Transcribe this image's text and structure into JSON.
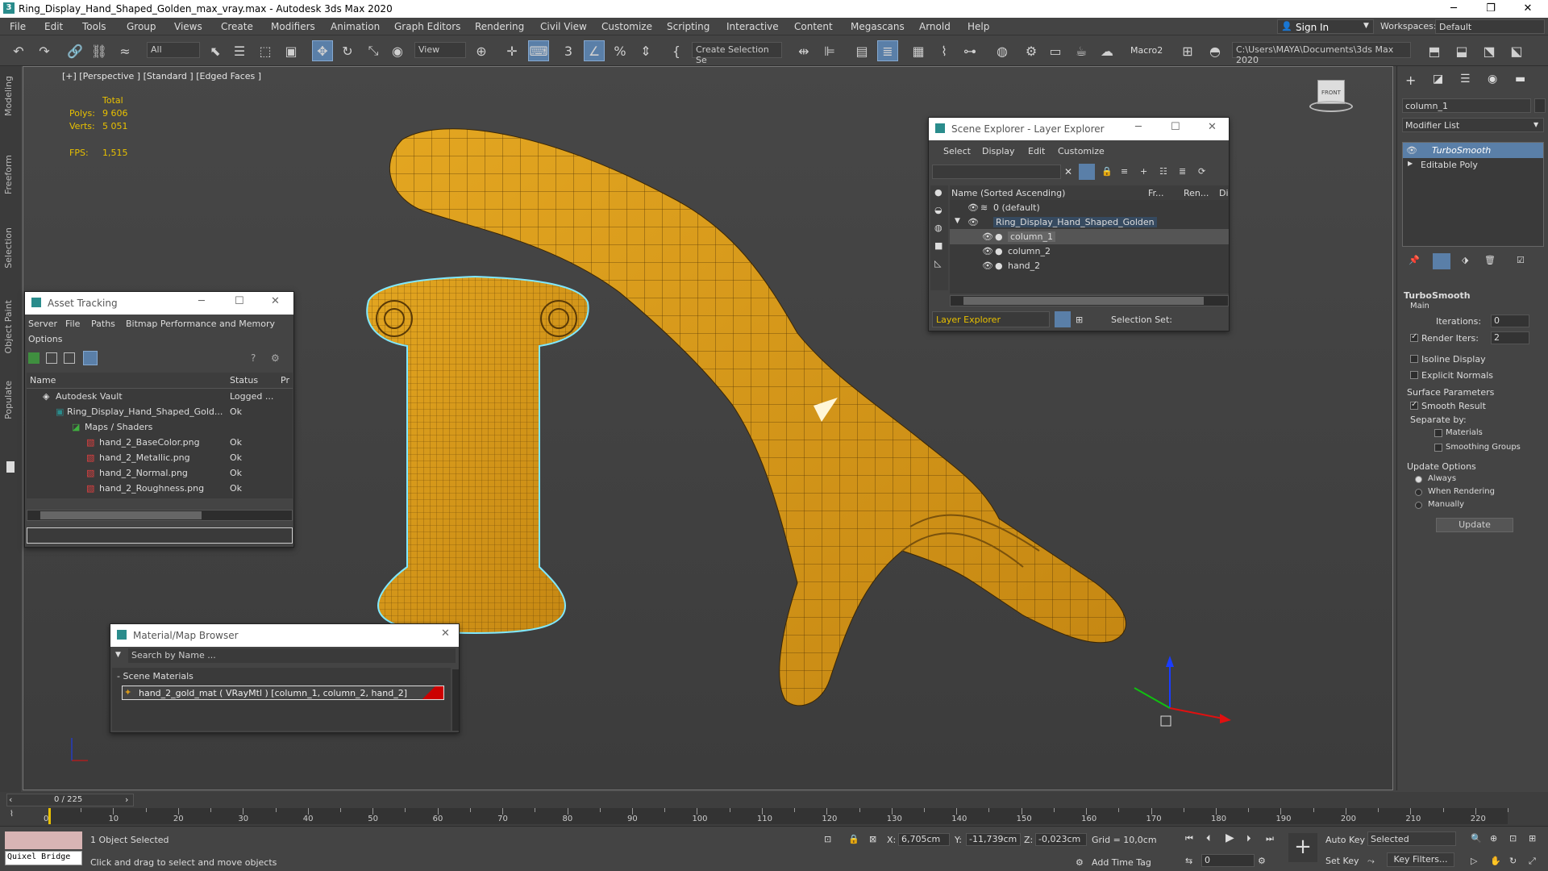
{
  "titlebar": {
    "title": "Ring_Display_Hand_Shaped_Golden_max_vray.max - Autodesk 3ds Max 2020"
  },
  "menu": [
    "File",
    "Edit",
    "Tools",
    "Group",
    "Views",
    "Create",
    "Modifiers",
    "Animation",
    "Graph Editors",
    "Rendering",
    "Civil View",
    "Customize",
    "Scripting",
    "Interactive",
    "Content",
    "Megascans",
    "Arnold",
    "Help"
  ],
  "account": {
    "signin": "Sign In",
    "workspaces_label": "Workspaces:",
    "workspace": "Default"
  },
  "toolbar": {
    "filter": "All",
    "ref_coord": "View",
    "selection_set": "Create Selection Se",
    "macro": "Macro2",
    "path": "C:\\Users\\MAYA\\Documents\\3ds Max 2020"
  },
  "ribbon_tabs": [
    "Modeling",
    "Freeform",
    "Selection",
    "Object Paint",
    "Populate"
  ],
  "viewport": {
    "label": "[+] [Perspective ] [Standard ] [Edged Faces ]",
    "stats": {
      "total_label": "Total",
      "polys_label": "Polys:",
      "polys": "9 606",
      "verts_label": "Verts:",
      "verts": "5 051",
      "fps_label": "FPS:",
      "fps": "1,515"
    },
    "viewcube": "FRONT"
  },
  "scene_explorer": {
    "title": "Scene Explorer - Layer Explorer",
    "menu": [
      "Select",
      "Display",
      "Edit",
      "Customize"
    ],
    "columns": {
      "name": "Name (Sorted Ascending)",
      "freeze": "Fr...",
      "render": "Ren...",
      "display": "Di"
    },
    "rows": [
      {
        "label": "0 (default)"
      },
      {
        "label": "Ring_Display_Hand_Shaped_Golden"
      },
      {
        "label": "column_1"
      },
      {
        "label": "column_2"
      },
      {
        "label": "hand_2"
      }
    ],
    "footer_explorer": "Layer Explorer",
    "footer_selset": "Selection Set:"
  },
  "asset_tracking": {
    "title": "Asset Tracking",
    "menu": [
      "Server",
      "File",
      "Paths",
      "Bitmap Performance and Memory",
      "Options"
    ],
    "columns": {
      "name": "Name",
      "status": "Status",
      "pr": "Pr"
    },
    "rows": [
      {
        "name": "Autodesk Vault",
        "status": "Logged ..."
      },
      {
        "name": "Ring_Display_Hand_Shaped_Gold...",
        "status": "Ok"
      },
      {
        "name": "Maps / Shaders",
        "status": ""
      },
      {
        "name": "hand_2_BaseColor.png",
        "status": "Ok"
      },
      {
        "name": "hand_2_Metallic.png",
        "status": "Ok"
      },
      {
        "name": "hand_2_Normal.png",
        "status": "Ok"
      },
      {
        "name": "hand_2_Roughness.png",
        "status": "Ok"
      }
    ]
  },
  "material_browser": {
    "title": "Material/Map Browser",
    "search_placeholder": "Search by Name ...",
    "group": "- Scene Materials",
    "material": "hand_2_gold_mat  ( VRayMtl ) [column_1, column_2, hand_2]"
  },
  "command_panel": {
    "object_name": "column_1",
    "modifier_list": "Modifier List",
    "stack": [
      "TurboSmooth",
      "Editable Poly"
    ],
    "rollout": "TurboSmooth",
    "main": "Main",
    "iterations_label": "Iterations:",
    "iterations": "0",
    "render_iters_label": "Render Iters:",
    "render_iters": "2",
    "isoline": "Isoline Display",
    "explicit_normals": "Explicit Normals",
    "surface_params": "Surface Parameters",
    "smooth_result": "Smooth Result",
    "separate_by": "Separate by:",
    "materials": "Materials",
    "smoothing_groups": "Smoothing Groups",
    "update_options": "Update Options",
    "always": "Always",
    "when_rendering": "When Rendering",
    "manually": "Manually",
    "update_button": "Update"
  },
  "timeline": {
    "frame": "0 / 225",
    "ticks": [
      "0",
      "10",
      "20",
      "30",
      "40",
      "50",
      "60",
      "70",
      "80",
      "90",
      "100",
      "110",
      "120",
      "130",
      "140",
      "150",
      "160",
      "170",
      "180",
      "190",
      "200",
      "210",
      "220"
    ]
  },
  "status": {
    "quixel": "Quixel Bridge",
    "selected": "1 Object Selected",
    "prompt": "Click and drag to select and move objects",
    "x_label": "X:",
    "x": "6,705cm",
    "y_label": "Y:",
    "y": "-11,739cm",
    "z_label": "Z:",
    "z": "-0,023cm",
    "grid": "Grid = 10,0cm",
    "add_time_tag": "Add Time Tag",
    "auto_key": "Auto Key",
    "set_key": "Set Key",
    "selected_dropdown": "Selected",
    "key_filters": "Key Filters...",
    "frame_field": "0"
  },
  "colors": {
    "accent": "#5a7fa8",
    "gold": "#d89a1a",
    "stats": "#e8c000",
    "selection": "#7fe8ff"
  }
}
